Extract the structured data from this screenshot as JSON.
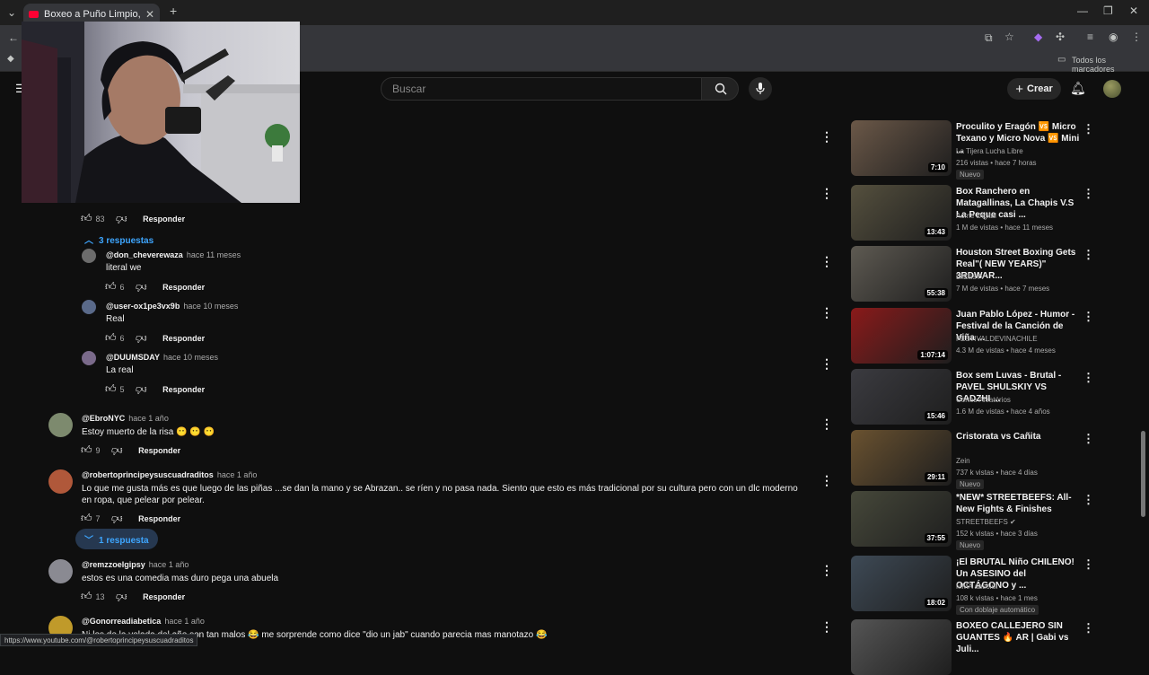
{
  "browser": {
    "tab_title": "Boxeo a Puño Limpio, en Chiva",
    "bookmarks_label": "Todos los marcadores",
    "status_url": "https://www.youtube.com/@robertoprincipeysuscuadraditos"
  },
  "header": {
    "search_placeholder": "Buscar",
    "create_label": "Crear"
  },
  "comments": {
    "c0": {
      "likes": "83",
      "reply_label": "Responder",
      "replies_label": "3 respuestas"
    },
    "r1": {
      "user": "@don_cheverewaza",
      "time": "hace 11 meses",
      "text": "literal we",
      "likes": "6",
      "reply_label": "Responder"
    },
    "r2": {
      "user": "@user-ox1pe3vx9b",
      "time": "hace 10 meses",
      "text": "Real",
      "likes": "6",
      "reply_label": "Responder"
    },
    "r3": {
      "user": "@DUUMSDAY",
      "time": "hace 10 meses",
      "text": "La real",
      "likes": "5",
      "reply_label": "Responder"
    },
    "c1": {
      "user": "@EbroNYC",
      "time": "hace 1 año",
      "text": "Estoy muerto de la risa 😶 😶 😶",
      "likes": "9",
      "reply_label": "Responder"
    },
    "c2": {
      "user": "@robertoprincipeysuscuadraditos",
      "time": "hace 1 año",
      "text": "Lo que me gusta más es que luego de las piñas ...se dan la mano y se Abrazan.. se ríen y no pasa nada. Siento que esto es más tradicional por su cultura pero con un dlc moderno en ropa, que pelear por pelear.",
      "likes": "7",
      "reply_label": "Responder",
      "replies_label": "1 respuesta"
    },
    "c3": {
      "user": "@remzzoelgipsy",
      "time": "hace 1 año",
      "text": "estos es una comedia  mas duro pega una abuela",
      "likes": "13",
      "reply_label": "Responder"
    },
    "c4": {
      "user": "@Gonorreadiabetica",
      "time": "hace 1 año",
      "text": "Ni los de la velada del año son tan malos 😂 me sorprende como dice \"dio un jab\" cuando parecia mas manotazo 😂"
    }
  },
  "videos": [
    {
      "title": "Proculito y Eragón 🆚 Micro Texano y Micro Nova 🆚 Mini ...",
      "channel": "La Tijera Lucha Libre",
      "views": "216 vistas",
      "age": "hace 7 horas",
      "badge": "Nuevo",
      "duration": "7:10",
      "color": "#6b5848"
    },
    {
      "title": "Box Ranchero en Matagallinas, La Chapis V.S La Peque casi ...",
      "channel": "Acme Digital",
      "views": "1 M de vistas",
      "age": "hace 11 meses",
      "badge": "",
      "duration": "13:43",
      "color": "#55503e"
    },
    {
      "title": "Houston Street Boxing Gets Real\"( NEW YEARS)\" 3RDWAR...",
      "channel": "LilEllisTv",
      "views": "7 M de vistas",
      "age": "hace 7 meses",
      "badge": "",
      "duration": "55:38",
      "color": "#5e5a52"
    },
    {
      "title": "Juan Pablo López - Humor - Festival de la Canción de Viña ...",
      "channel": "FESTIVALDEVINACHILE",
      "views": "4.3 M de vistas",
      "age": "hace 4 meses",
      "badge": "",
      "duration": "1:07:14",
      "color": "#8a1a1a"
    },
    {
      "title": "Box sem Luvas - Brutal - PAVEL SHULSKIY VS GADZHI ...",
      "channel": "Cortes Aleatórios",
      "views": "1.6 M de vistas",
      "age": "hace 4 años",
      "badge": "",
      "duration": "15:46",
      "color": "#3b3b40"
    },
    {
      "title": "Cristorata vs Cañita",
      "channel": "Zein",
      "views": "737 k vistas",
      "age": "hace 4 días",
      "badge": "Nuevo",
      "duration": "29:11",
      "color": "#6a5230"
    },
    {
      "title": "*NEW* STREETBEEFS: All-New Fights & Finishes",
      "channel": "STREETBEEFS ✔",
      "views": "152 k vistas",
      "age": "hace 3 días",
      "badge": "Nuevo",
      "duration": "37:55",
      "color": "#46483a"
    },
    {
      "title": "¡El BRUTAL Niño CHILENO! Un ASESINO del OCTÁGONO y ...",
      "channel": "MMA absolut",
      "views": "108 k vistas",
      "age": "hace 1 mes",
      "badge": "Con doblaje automático",
      "duration": "18:02",
      "color": "#3e4a56"
    },
    {
      "title": "BOXEO CALLEJERO SIN GUANTES 🔥 AR | Gabi vs Juli...",
      "channel": "",
      "views": "",
      "age": "",
      "badge": "",
      "duration": "",
      "color": "#555"
    }
  ]
}
